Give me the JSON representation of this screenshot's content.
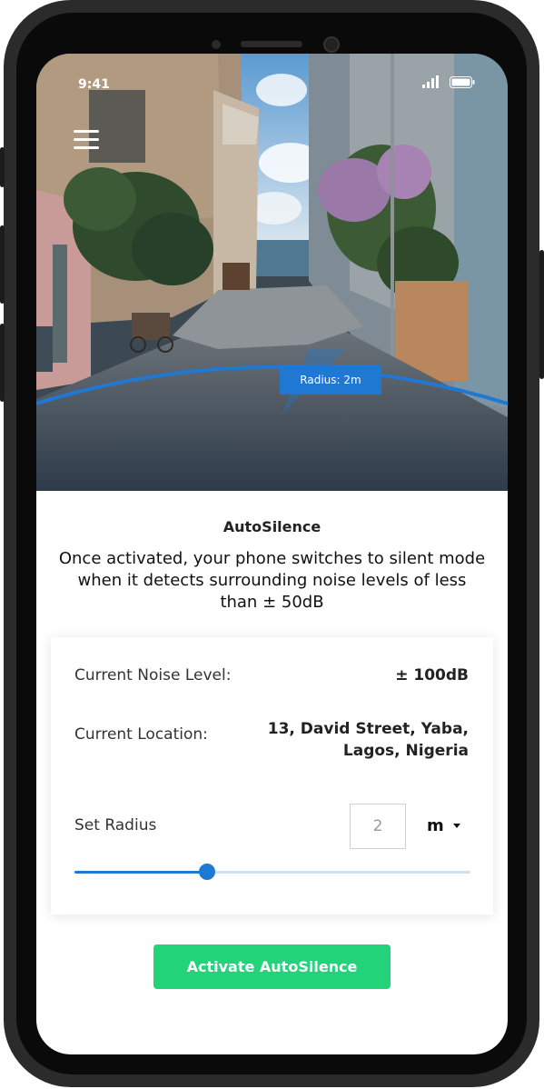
{
  "status_bar": {
    "time": "9:41",
    "signal_icon": "signal-bars-icon",
    "battery_icon": "battery-icon"
  },
  "header": {
    "menu_icon": "hamburger-menu-icon"
  },
  "map_overlay": {
    "radius_label": "Radius: 2m",
    "accent": "#1f78d1"
  },
  "main": {
    "title": "AutoSilence",
    "description": "Once activated, your phone switches to silent mode when it detects surrounding noise levels of less than ± 50dB"
  },
  "card": {
    "noise_label": "Current Noise Level:",
    "noise_value": "± 100dB",
    "location_label": "Current Location:",
    "location_line1": "13, David Street, Yaba,",
    "location_line2": "Lagos, Nigeria",
    "radius_label": "Set Radius",
    "radius_value": "2",
    "unit_value": "m",
    "slider_fraction": 0.335
  },
  "activate_button": {
    "label": "Activate AutoSilence",
    "color": "#22d37a"
  }
}
